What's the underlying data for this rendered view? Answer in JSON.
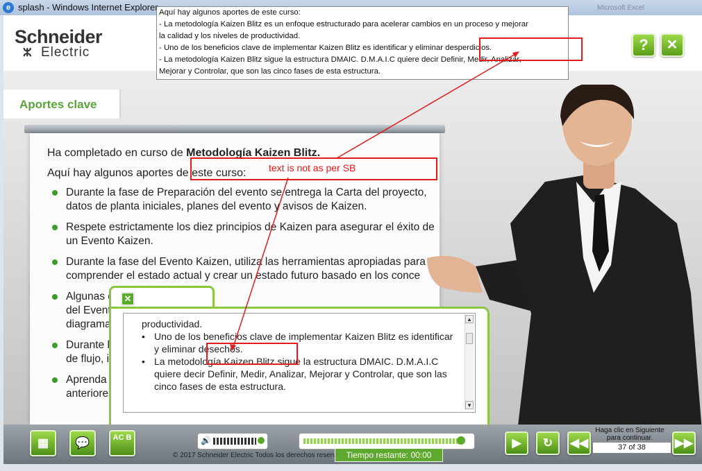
{
  "window": {
    "title": "splash - Windows Internet Explorer",
    "app_icon": "ie-icon",
    "blurred_right_text": "Microsoft Excel"
  },
  "logo": {
    "line1": "Schneider",
    "line2": "Electric"
  },
  "top_buttons": {
    "help_label": "?",
    "close_label": "✕"
  },
  "section": {
    "title": "Aportes clave"
  },
  "board": {
    "intro_prefix": "Ha completado en curso de ",
    "intro_bold": "Metodología Kaizen Blitz.",
    "subtitle": "Aquí hay algunos aportes de este curso:",
    "bullets": [
      "Durante la fase de Preparación del evento se entrega la Carta del proyecto, datos de planta iniciales, planes del evento y avisos de Kaizen.",
      "Respete estrictamente los diez principios de Kaizen para asegurar el éxito de un Evento Kaizen.",
      "Durante la fase del Evento Kaizen, utiliza las herramientas apropiadas para comprender el estado actual y crear un estado futuro basado en los conce",
      "Algunas d",
      "del Event",
      "diagrama",
      "Durante l",
      "de flujo, i",
      "Aprenda",
      "anteriores"
    ]
  },
  "popup": {
    "close_label": "✕",
    "lines": [
      "productividad.",
      "Uno de los beneficios clave de implementar Kaizen Blitz es identificar y eliminar desechos.",
      "La metodología Kaizen Blitz sigue la estructura DMAIC. D.M.A.I.C quiere decir Definir, Medir, Analizar, Mejorar y Controlar, que son las cinco fases de esta estructura."
    ]
  },
  "annotation": {
    "box_lines": [
      "Aquí hay algunos aportes de este curso:",
      " - La metodología Kaizen Blitz es un enfoque estructurado para acelerar cambios en un proceso y mejorar",
      "la calidad y los niveles de productividad.",
      " - Uno de los beneficios clave de implementar Kaizen Blitz es identificar y eliminar desperdicios.",
      " - La metodología Kaizen Blitz sigue la estructura DMAIC. D.M.A.I.C quiere decir Definir, Medir, Analizar,",
      "Mejorar y Controlar, que son las cinco fases de esta estructura."
    ],
    "note": "text is not as per SB",
    "color": "#e21b1b"
  },
  "bottom": {
    "copyright": "© 2017 Schneider Electric Todos los derechos reservados.",
    "time_label": "Tiempo restante:  00:00",
    "hint": "Haga clic en Siguiente para continuar.",
    "page_indicator": "37 of 38",
    "progress": 0.97,
    "glossary_label": "AC B",
    "icons": [
      "sitemap-icon",
      "chat-icon",
      "glossary-icon",
      "speaker-icon",
      "play-icon",
      "replay-icon",
      "rewind-icon",
      "forward-icon"
    ]
  },
  "colors": {
    "accent_green": "#5aa33a",
    "frame_green": "#8cc63f"
  }
}
